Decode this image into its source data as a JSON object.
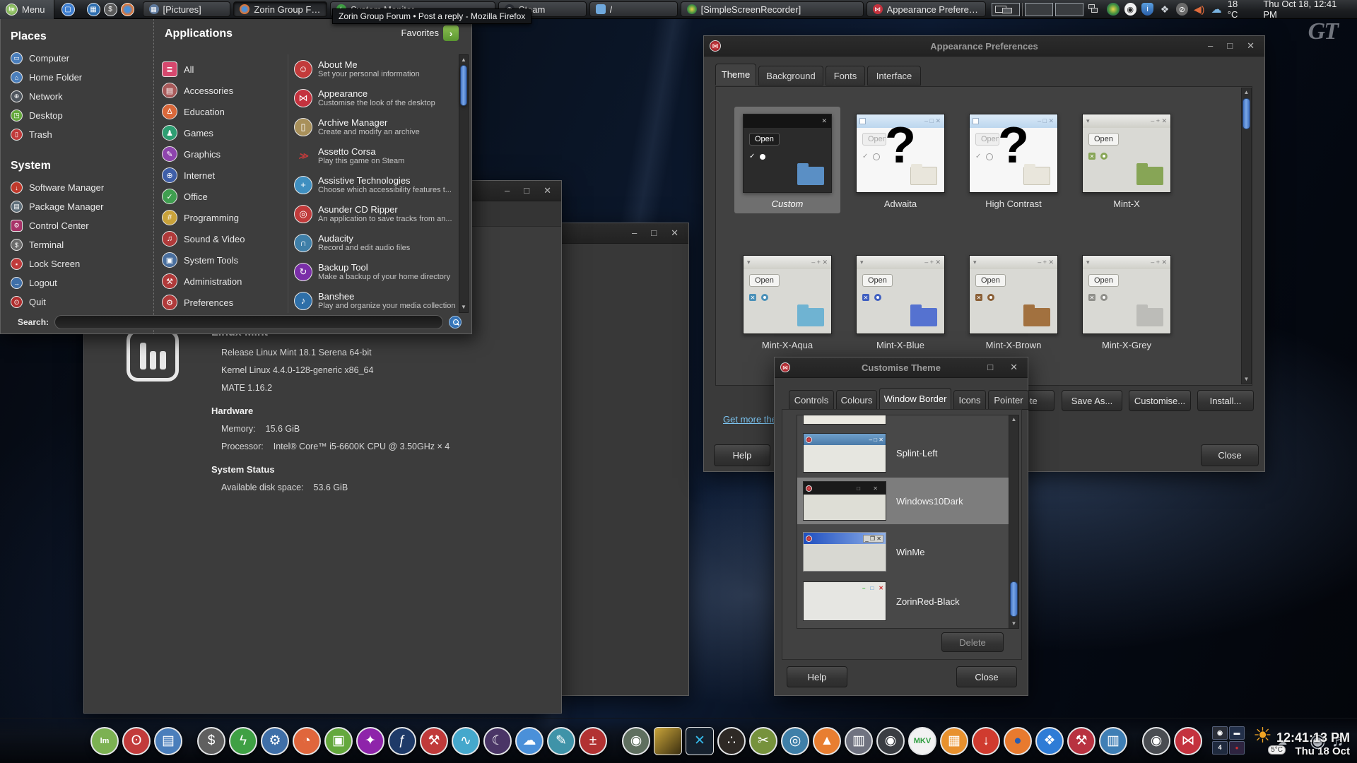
{
  "colors": {
    "accent_blue": "#4a7fd0",
    "link_blue": "#7cc4f0",
    "brand_red": "#c4323e",
    "selection_grey": "#6f6f6f"
  },
  "glyphs": {
    "minimize": "–",
    "maximize": "□",
    "close": "✕",
    "menu_arrow": "›",
    "scroll_up": "▲",
    "scroll_down": "▼"
  },
  "wallpaper": {
    "logo_text": "GT"
  },
  "tooltip": "Zorin Group Forum • Post a reply - Mozilla Firefox",
  "panel": {
    "menu_label": "Menu",
    "taskbar": [
      {
        "label": "[Pictures]"
      },
      {
        "label": "Zorin Group Forum • P..."
      },
      {
        "label": "System Monitor"
      },
      {
        "label": "Steam"
      },
      {
        "label": "/"
      },
      {
        "label": "[SimpleScreenRecorder]"
      },
      {
        "label": "Appearance Preferenc..."
      }
    ],
    "temperature": "18 °C",
    "clock": "Thu Oct 18, 12:41 PM"
  },
  "menu": {
    "places_title": "Places",
    "places": [
      {
        "label": "Computer"
      },
      {
        "label": "Home Folder"
      },
      {
        "label": "Network"
      },
      {
        "label": "Desktop"
      },
      {
        "label": "Trash"
      }
    ],
    "system_title": "System",
    "system": [
      {
        "label": "Software Manager"
      },
      {
        "label": "Package Manager"
      },
      {
        "label": "Control Center"
      },
      {
        "label": "Terminal"
      },
      {
        "label": "Lock Screen"
      },
      {
        "label": "Logout"
      },
      {
        "label": "Quit"
      }
    ],
    "applications_title": "Applications",
    "favorites_label": "Favorites",
    "categories": [
      {
        "label": "All"
      },
      {
        "label": "Accessories"
      },
      {
        "label": "Education"
      },
      {
        "label": "Games"
      },
      {
        "label": "Graphics"
      },
      {
        "label": "Internet"
      },
      {
        "label": "Office"
      },
      {
        "label": "Programming"
      },
      {
        "label": "Sound & Video"
      },
      {
        "label": "System Tools"
      },
      {
        "label": "Administration"
      },
      {
        "label": "Preferences"
      }
    ],
    "apps": [
      {
        "name": "About Me",
        "desc": "Set your personal information"
      },
      {
        "name": "Appearance",
        "desc": "Customise the look of the desktop"
      },
      {
        "name": "Archive Manager",
        "desc": "Create and modify an archive"
      },
      {
        "name": "Assetto Corsa",
        "desc": "Play this game on Steam"
      },
      {
        "name": "Assistive Technologies",
        "desc": "Choose which accessibility features t..."
      },
      {
        "name": "Asunder CD Ripper",
        "desc": "An application to save tracks from an..."
      },
      {
        "name": "Audacity",
        "desc": "Record and edit audio files"
      },
      {
        "name": "Backup Tool",
        "desc": "Make a backup of your home directory"
      },
      {
        "name": "Banshee",
        "desc": "Play and organize your media collection"
      }
    ],
    "search_label": "Search:"
  },
  "system_monitor": {
    "distro": "Linux Mint",
    "release": "Release Linux Mint 18.1 Serena 64-bit",
    "kernel": "Kernel Linux 4.4.0-128-generic x86_64",
    "desktop_env": "MATE 1.16.2",
    "hardware_title": "Hardware",
    "memory_label": "Memory:",
    "memory_value": "15.6 GiB",
    "processor_label": "Processor:",
    "processor_value": "Intel® Core™ i5-6600K CPU @ 3.50GHz × 4",
    "status_title": "System Status",
    "disk_label": "Available disk space:",
    "disk_value": "53.6 GiB"
  },
  "appearance": {
    "title": "Appearance Preferences",
    "tabs": [
      {
        "label": "Theme"
      },
      {
        "label": "Background"
      },
      {
        "label": "Fonts"
      },
      {
        "label": "Interface"
      }
    ],
    "thumb_open": "Open",
    "question_mark": "?",
    "themes": [
      {
        "label": "Custom"
      },
      {
        "label": "Adwaita"
      },
      {
        "label": "High Contrast"
      },
      {
        "label": "Mint-X"
      },
      {
        "label": "Mint-X-Aqua"
      },
      {
        "label": "Mint-X-Blue"
      },
      {
        "label": "Mint-X-Brown"
      },
      {
        "label": "Mint-X-Grey"
      }
    ],
    "delete_label": "Delete",
    "save_as_label": "Save As...",
    "customise_label": "Customise...",
    "install_label": "Install...",
    "link": "Get more themes online",
    "help_label": "Help",
    "close_label": "Close"
  },
  "customise_theme": {
    "title": "Customise Theme",
    "tabs": [
      {
        "label": "Controls"
      },
      {
        "label": "Colours"
      },
      {
        "label": "Window Border"
      },
      {
        "label": "Icons"
      },
      {
        "label": "Pointer"
      }
    ],
    "borders": [
      {
        "label": "Splint-Left"
      },
      {
        "label": "Windows10Dark"
      },
      {
        "label": "WinMe"
      },
      {
        "label": "ZorinRed-Black"
      }
    ],
    "delete_label": "Delete",
    "help_label": "Help",
    "close_label": "Close"
  },
  "dock": {
    "badge": "4",
    "weather_temp": "5°C",
    "clock_time": "12:41:13 PM",
    "clock_date": "Thu 18 Oct",
    "icons": [
      {
        "name": "mint-menu-icon",
        "glyph": "lm",
        "bg": "#7cb152",
        "fs": "11px"
      },
      {
        "name": "shutdown-icon",
        "glyph": "ʘ",
        "bg": "#c23b3b"
      },
      {
        "name": "show-desktop-icon",
        "glyph": "▤",
        "bg": "#4a7ebb"
      },
      {
        "name": "terminal-icon",
        "glyph": "$",
        "bg": "#5f5f5f",
        "gap": true
      },
      {
        "name": "system-monitor-icon",
        "glyph": "ϟ",
        "bg": "#3fa044"
      },
      {
        "name": "control-center-icon",
        "glyph": "⚙",
        "bg": "#3f6fa8"
      },
      {
        "name": "disk-usage-icon",
        "glyph": "◔",
        "bg": "#e0663c"
      },
      {
        "name": "file-manager-icon",
        "glyph": "▣",
        "bg": "#64a83c"
      },
      {
        "name": "usb-stick-icon",
        "glyph": "✦",
        "bg": "#8e24aa"
      },
      {
        "name": "usb-image-writer-icon",
        "glyph": "ƒ",
        "bg": "#1e3a68"
      },
      {
        "name": "software-sources-icon",
        "glyph": "⚒",
        "bg": "#c03a3a"
      },
      {
        "name": "resource-monitor-icon",
        "glyph": "∿",
        "bg": "#45a8cc"
      },
      {
        "name": "screensaver-icon",
        "glyph": "☾",
        "bg": "#4a3566"
      },
      {
        "name": "weather-app-icon",
        "glyph": "☁",
        "bg": "#4a90d9"
      },
      {
        "name": "text-editor-icon",
        "glyph": "✎",
        "bg": "#3f93a8"
      },
      {
        "name": "calculator-icon",
        "glyph": "±",
        "bg": "#b23232"
      },
      {
        "name": "screen-recorder-icon",
        "glyph": "◉",
        "bg": "#5f6f5f",
        "gap": true
      },
      {
        "name": "image-thumbnail-icon",
        "glyph": "",
        "bg": "linear-gradient(135deg,#caa53a,#3a2e10)",
        "shape": "square"
      },
      {
        "name": "video-editor-icon",
        "glyph": "✕",
        "bg": "#16212e",
        "fg": "#35b8e8",
        "shape": "square"
      },
      {
        "name": "iota-icon",
        "glyph": "∴",
        "bg": "#2e2925"
      },
      {
        "name": "utilities-icon",
        "glyph": "✂",
        "bg": "#76923c"
      },
      {
        "name": "log-viewer-icon",
        "glyph": "◎",
        "bg": "#3f7fa8"
      },
      {
        "name": "vlc-icon",
        "glyph": "▲",
        "bg": "#e87e31"
      },
      {
        "name": "film-strip-icon",
        "glyph": "▥",
        "bg": "#6f7280"
      },
      {
        "name": "steam-dock-icon",
        "glyph": "◉",
        "bg": "#3a3d42"
      },
      {
        "name": "mkv-tool-icon",
        "glyph": "MKV",
        "bg": "#f2f2f2",
        "fg": "#2e9e3f",
        "fs": "11px"
      },
      {
        "name": "pineapple-icon",
        "glyph": "▦",
        "bg": "#e8912e"
      },
      {
        "name": "downloader-icon",
        "glyph": "↓",
        "bg": "#d03b2f"
      },
      {
        "name": "firefox-icon",
        "glyph": "●",
        "bg": "#e87a2e",
        "fg": "#2a5db0"
      },
      {
        "name": "dropbox-icon",
        "glyph": "❖",
        "bg": "#2f7cd6"
      },
      {
        "name": "wine-tools-icon",
        "glyph": "⚒",
        "bg": "#b83240"
      },
      {
        "name": "archive-manager-icon",
        "glyph": "▥",
        "bg": "#3f7fb5"
      },
      {
        "name": "steam-grey-icon",
        "glyph": "◉",
        "bg": "#4a4d52",
        "gap": true
      },
      {
        "name": "appearance-dock-icon",
        "glyph": "⋈",
        "bg": "#c4323e"
      }
    ]
  }
}
